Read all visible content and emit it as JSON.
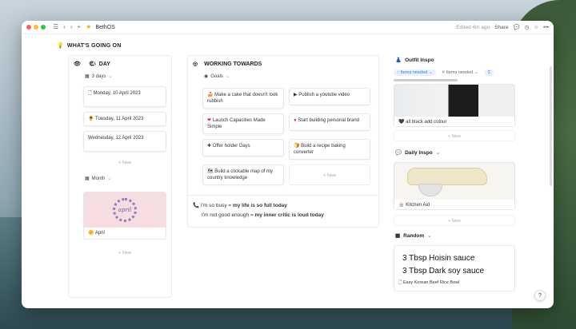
{
  "window": {
    "title": "BethOS",
    "edited": "Edited 4m ago",
    "share": "Share",
    "colors": {
      "close": "#ff5f57",
      "min": "#febc2e",
      "max": "#28c840",
      "link": "#2f7ee8"
    }
  },
  "page": {
    "heading": "WHAT'S GOING ON"
  },
  "day": {
    "title": "DAY",
    "view1": "3 days",
    "cards": [
      {
        "icon": "page-icon",
        "text": "Monday, 10 April 2023"
      },
      {
        "icon": "sun-icon",
        "text": "Tuesday, 11 April 2023"
      },
      {
        "icon": "",
        "text": "Wednesday, 12 April 2023"
      }
    ],
    "new1": "+ New",
    "view2": "Month",
    "month_card": {
      "image_text": "april",
      "label": "April"
    },
    "new2": "+ New"
  },
  "working": {
    "title": "WORKING TOWARDS",
    "view": "Goals",
    "goals": [
      {
        "text": "Make a cake that doesn't look rubbish"
      },
      {
        "text": "Publish a youtube video"
      },
      {
        "text": "Launch Capacities Made Simple"
      },
      {
        "text": "Start building personal brand"
      },
      {
        "text": "Offer holder Days"
      },
      {
        "text": "Build a recipe baking converter"
      },
      {
        "text": "Build a clickable map of my country knowledge"
      }
    ],
    "new": "+ New",
    "quote1_a": "I'm so busy = ",
    "quote1_b": "my life is so full today",
    "quote2_a": "I'm not good enough = ",
    "quote2_b": "my inner critic is loud today"
  },
  "outfit": {
    "title": "Outfit Inspo",
    "chip1": "Items needed",
    "chip2": "Items needed",
    "chip3": "Σ",
    "card_label": "all black add colour",
    "new": "+ New"
  },
  "daily": {
    "title": "Daily Inspo",
    "card_label": "Kitchen Aid",
    "new": "+ New"
  },
  "random": {
    "title": "Random",
    "line1": "3 Tbsp Hoisin sauce",
    "line2": "3 Tbsp Dark soy sauce",
    "card_label": "Easy Korean Beef Rice Bowl"
  },
  "help": "?"
}
